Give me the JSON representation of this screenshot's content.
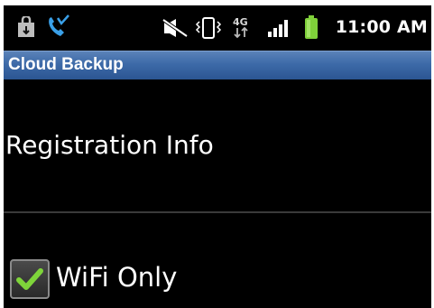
{
  "status_bar": {
    "time": "11:00 AM",
    "network_label": "4G",
    "icons": [
      "shopping-bag-icon",
      "missed-call-icon",
      "mute-icon",
      "vibrate-icon",
      "4g-data-icon",
      "signal-bars-icon",
      "battery-icon"
    ],
    "battery_color": "#7fd03a"
  },
  "app_bar": {
    "title": "Cloud Backup",
    "color": "#3d6aa8"
  },
  "preferences": {
    "registration": {
      "title": "Registration Info"
    },
    "wifi_only": {
      "label": "WiFi Only",
      "checked": true,
      "check_color": "#7ed43a"
    }
  }
}
